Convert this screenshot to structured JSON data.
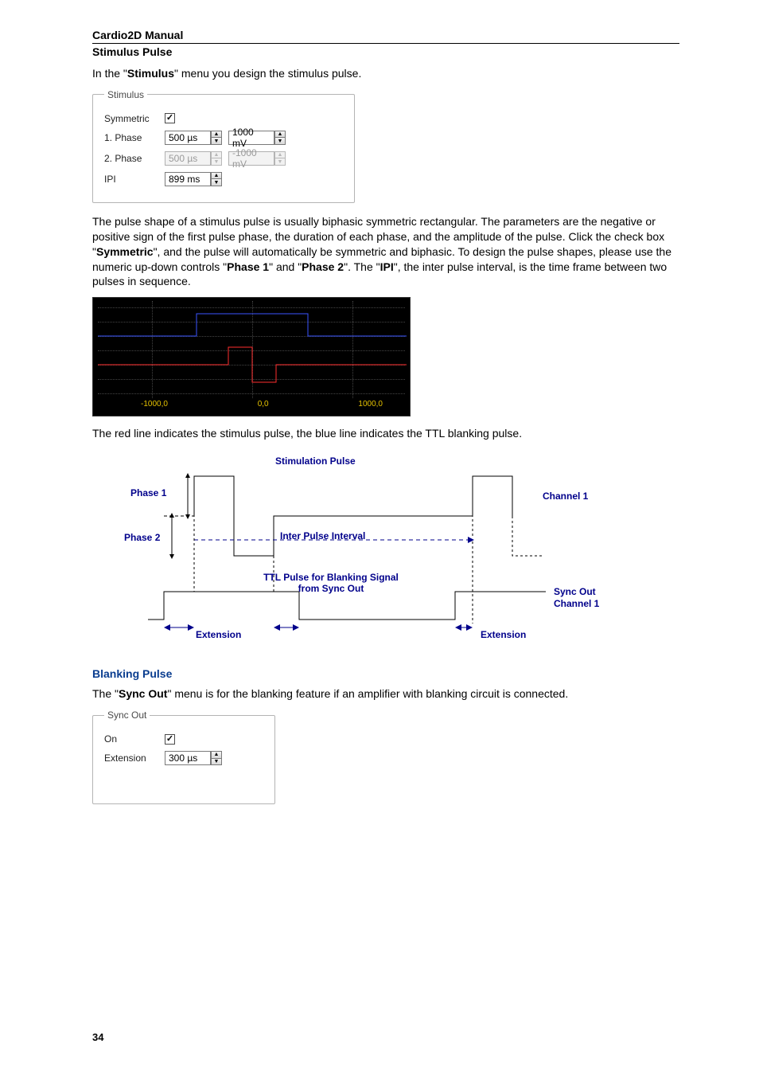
{
  "doc_title": "Cardio2D Manual",
  "section_stimulus": {
    "heading": "Stimulus Pulse",
    "intro_pre": "In the \"",
    "intro_bold": "Stimulus",
    "intro_post": "\" menu you design the stimulus pulse.",
    "legend": "Stimulus",
    "rows": {
      "symmetric": "Symmetric",
      "phase1": "1. Phase",
      "phase2": "2. Phase",
      "ipi": "IPI"
    },
    "values": {
      "phase1_time": "500 µs",
      "phase1_amp": "1000 mV",
      "phase2_time": "500 µs",
      "phase2_amp": "-1000 mV",
      "ipi": "899 ms"
    },
    "para2_parts": [
      "The pulse shape of a stimulus pulse is usually biphasic symmetric rectangular. The parameters are the negative or positive sign of the first pulse phase, the duration of each phase, and the amplitude of the pulse. Click the check box \"",
      "Symmetric",
      "\", and the pulse will automatically be symmetric and biphasic. To design the pulse shapes, please use the numeric up-down controls \"",
      "Phase 1",
      "\" and \"",
      "Phase 2",
      "\". The \"",
      "IPI",
      "\", the inter pulse interval, is the time frame between two pulses in sequence."
    ],
    "scope_ticks": {
      "left": "-1000,0",
      "center": "0,0",
      "right": "1000,0"
    },
    "caption_after_scope": "The red line indicates the stimulus pulse, the blue line indicates the TTL blanking pulse."
  },
  "diagram": {
    "title": "Stimulation Pulse",
    "phase1": "Phase 1",
    "phase2": "Phase 2",
    "ipi": "Inter Pulse Interval",
    "ttl_line1": "TTL Pulse for Blanking Signal",
    "ttl_line2": "from Sync Out",
    "channel1": "Channel 1",
    "syncout1": "Sync Out",
    "syncout2": "Channel 1",
    "extension": "Extension"
  },
  "section_blanking": {
    "heading": "Blanking Pulse",
    "para_parts": [
      "The \"",
      "Sync Out",
      "\" menu is for the blanking feature if an amplifier with blanking circuit is connected."
    ],
    "legend": "Sync Out",
    "on_label": "On",
    "ext_label": "Extension",
    "ext_value": "300 µs"
  },
  "page_number": "34"
}
